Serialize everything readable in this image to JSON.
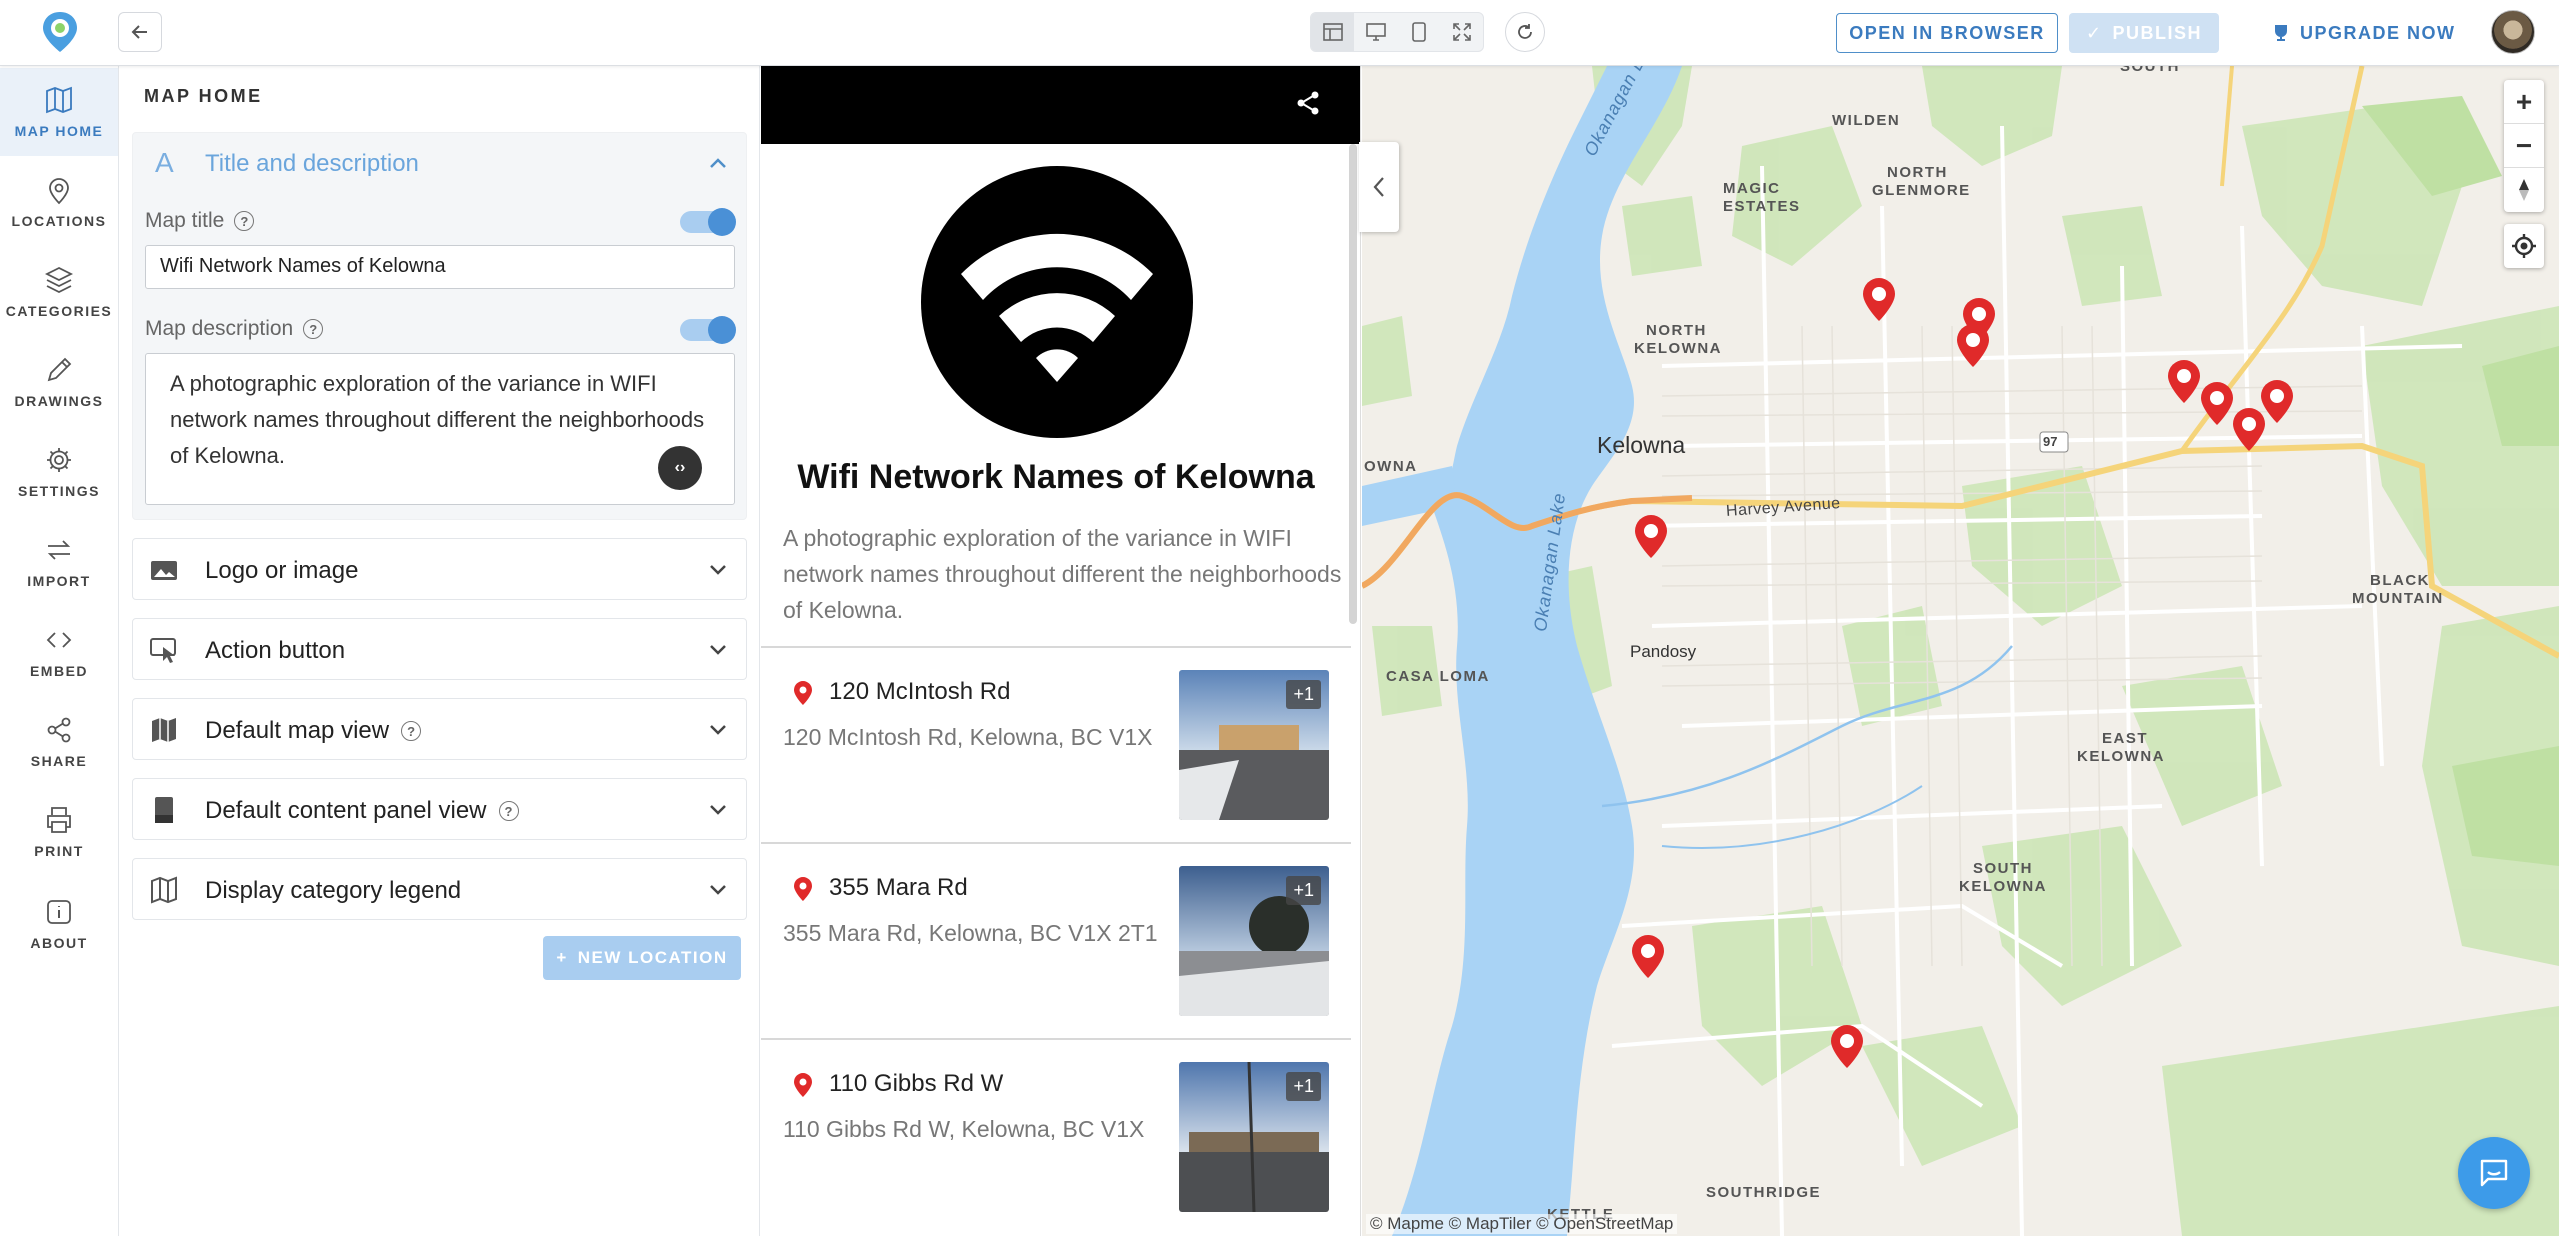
{
  "topbar": {
    "open_in_browser": "OPEN IN BROWSER",
    "publish": "PUBLISH",
    "upgrade": "UPGRADE NOW"
  },
  "nav": {
    "items": [
      {
        "label": "MAP HOME",
        "icon": "map-icon"
      },
      {
        "label": "LOCATIONS",
        "icon": "pin-icon"
      },
      {
        "label": "CATEGORIES",
        "icon": "layers-icon"
      },
      {
        "label": "DRAWINGS",
        "icon": "pencil-icon"
      },
      {
        "label": "SETTINGS",
        "icon": "gear-icon"
      },
      {
        "label": "IMPORT",
        "icon": "import-icon"
      },
      {
        "label": "EMBED",
        "icon": "code-icon"
      },
      {
        "label": "SHARE",
        "icon": "share-icon"
      },
      {
        "label": "PRINT",
        "icon": "print-icon"
      },
      {
        "label": "ABOUT",
        "icon": "info-icon"
      }
    ]
  },
  "panel": {
    "title": "MAP HOME",
    "title_section": {
      "heading": "Title and description",
      "map_title_label": "Map title",
      "map_title_value": "Wifi Network Names of Kelowna",
      "map_title_enabled": true,
      "map_desc_label": "Map description",
      "map_desc_value": "A photographic exploration of the variance in WIFI network names throughout different the neighborhoods of Kelowna.",
      "map_desc_enabled": true
    },
    "sections": [
      {
        "label": "Logo or image",
        "icon": "image-icon",
        "help": false
      },
      {
        "label": "Action button",
        "icon": "click-icon",
        "help": false
      },
      {
        "label": "Default map view",
        "icon": "map-icon",
        "help": true
      },
      {
        "label": "Default content panel view",
        "icon": "panel-icon",
        "help": true
      },
      {
        "label": "Display category legend",
        "icon": "map-icon",
        "help": false
      }
    ],
    "new_location": "NEW LOCATION"
  },
  "preview": {
    "title": "Wifi Network Names of Kelowna",
    "description": "A photographic exploration of the variance in WIFI network names throughout different the neighborhoods of Kelowna.",
    "locations": [
      {
        "name": "120 McIntosh Rd",
        "address": "120 McIntosh Rd, Kelowna, BC V1X",
        "badge": "+1"
      },
      {
        "name": "355 Mara Rd",
        "address": "355 Mara Rd, Kelowna, BC V1X 2T1",
        "badge": "+1"
      },
      {
        "name": "110 Gibbs Rd W",
        "address": "110 Gibbs Rd W, Kelowna, BC V1X",
        "badge": "+1"
      }
    ]
  },
  "map": {
    "labels": {
      "south": "SOUTH",
      "wilden": "WILDEN",
      "magic": "MAGIC",
      "estates": "ESTATES",
      "north": "NORTH",
      "glenmore": "GLENMORE",
      "north2": "NORTH",
      "kelowna_n": "KELOWNA",
      "kelowna": "Kelowna",
      "owna": "OWNA",
      "harvey": "Harvey Avenue",
      "hwy": "97",
      "casa_loma": "CASA LOMA",
      "pandosy": "Pandosy",
      "black": "BLACK",
      "mountain": "MOUNTAIN",
      "east": "EAST",
      "kelowna_e": "KELOWNA",
      "south2": "SOUTH",
      "kelowna_s": "KELOWNA",
      "southridge": "SOUTHRIDGE",
      "kettle": "KETTLE",
      "okanagan_lake_n": "Okanagan Lake",
      "okanagan_lake_s": "Okanagan Lake"
    },
    "attribution": "© Mapme  © MapTiler  © OpenStreetMap",
    "pin_color": "#e02a2a",
    "water_color": "#a9d3f5"
  }
}
